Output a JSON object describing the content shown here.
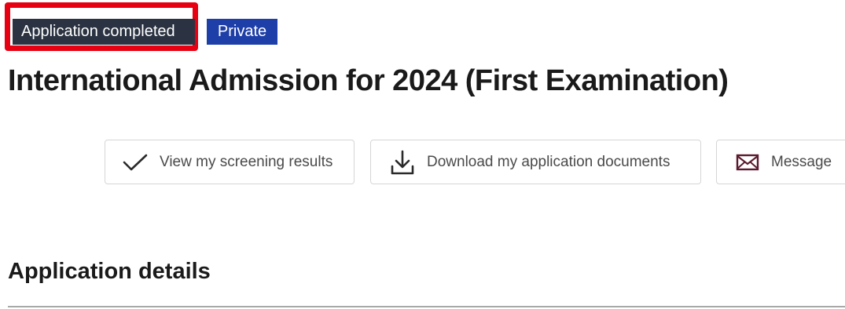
{
  "status": {
    "completed_label": "Application completed",
    "visibility_label": "Private",
    "highlight_color": "#e60012",
    "completed_bg": "#2b3342",
    "private_bg": "#1f3fa8"
  },
  "page": {
    "title": "International Admission for 2024 (First Examination)"
  },
  "actions": [
    {
      "label": "View my screening results",
      "icon": "checkmark-icon"
    },
    {
      "label": "Download my application documents",
      "icon": "download-icon"
    },
    {
      "label": "Message",
      "icon": "envelope-icon"
    }
  ],
  "section": {
    "title": "Application details"
  }
}
